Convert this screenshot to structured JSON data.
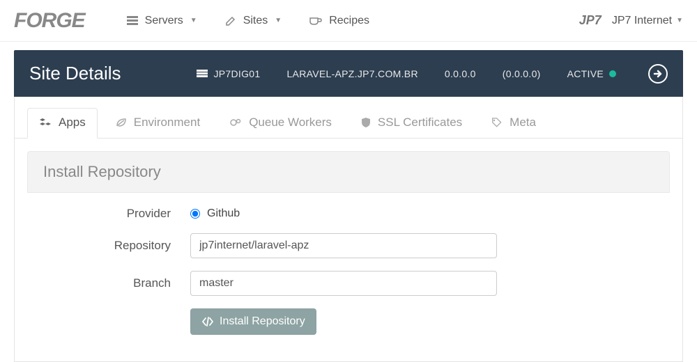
{
  "topnav": {
    "servers": "Servers",
    "sites": "Sites",
    "recipes": "Recipes",
    "account": "JP7 Internet"
  },
  "header": {
    "title": "Site Details",
    "server": "JP7DIG01",
    "domain": "LARAVEL-APZ.JP7.COM.BR",
    "ip": "0.0.0.0",
    "ip2": "(0.0.0.0)",
    "status": "ACTIVE"
  },
  "tabs": {
    "apps": "Apps",
    "environment": "Environment",
    "queue": "Queue Workers",
    "ssl": "SSL Certificates",
    "meta": "Meta"
  },
  "panel": {
    "title": "Install Repository"
  },
  "form": {
    "provider_label": "Provider",
    "provider_option": "Github",
    "repository_label": "Repository",
    "repository_value": "jp7internet/laravel-apz",
    "branch_label": "Branch",
    "branch_value": "master",
    "submit": "Install Repository"
  }
}
